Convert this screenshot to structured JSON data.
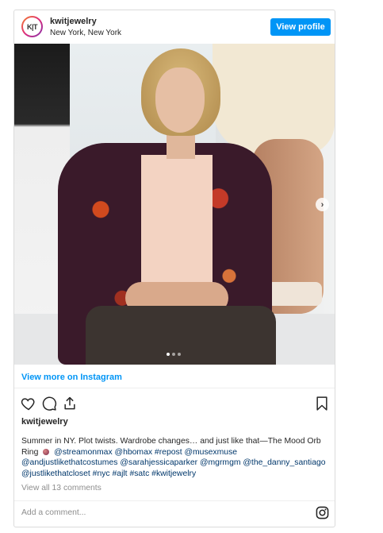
{
  "header": {
    "avatar_text": "K|T",
    "username": "kwitjewelry",
    "location": "New York, New York",
    "view_profile_label": "View profile"
  },
  "media": {
    "image_alt": "post image",
    "carousel_count": 3,
    "carousel_active": 1
  },
  "view_more_label": "View more on Instagram",
  "actions": {
    "icons": [
      "heart-icon",
      "comment-icon",
      "share-icon",
      "bookmark-icon"
    ]
  },
  "likes_label": "kwitjewelry",
  "caption": {
    "line1": "Summer in NY. Plot twists. Wardrobe changes… and just like that—The Mood Orb",
    "line2_prefix": "Ring",
    "line2_tags": "@streamonmax @hbomax #repost @musexmuse",
    "line3": "@andjustlikethatcostumes @sarahjessicaparker @mgrmgm @the_danny_santiago",
    "line4": "@justlikethatcloset #nyc #ajlt #satc #kwitjewelry"
  },
  "view_comments_label": "View all 13 comments",
  "add_comment_placeholder": "Add a comment...",
  "colors": {
    "accent": "#0095f6",
    "text": "#262626",
    "muted": "#8e8e8e",
    "border": "#dbdbdb"
  }
}
